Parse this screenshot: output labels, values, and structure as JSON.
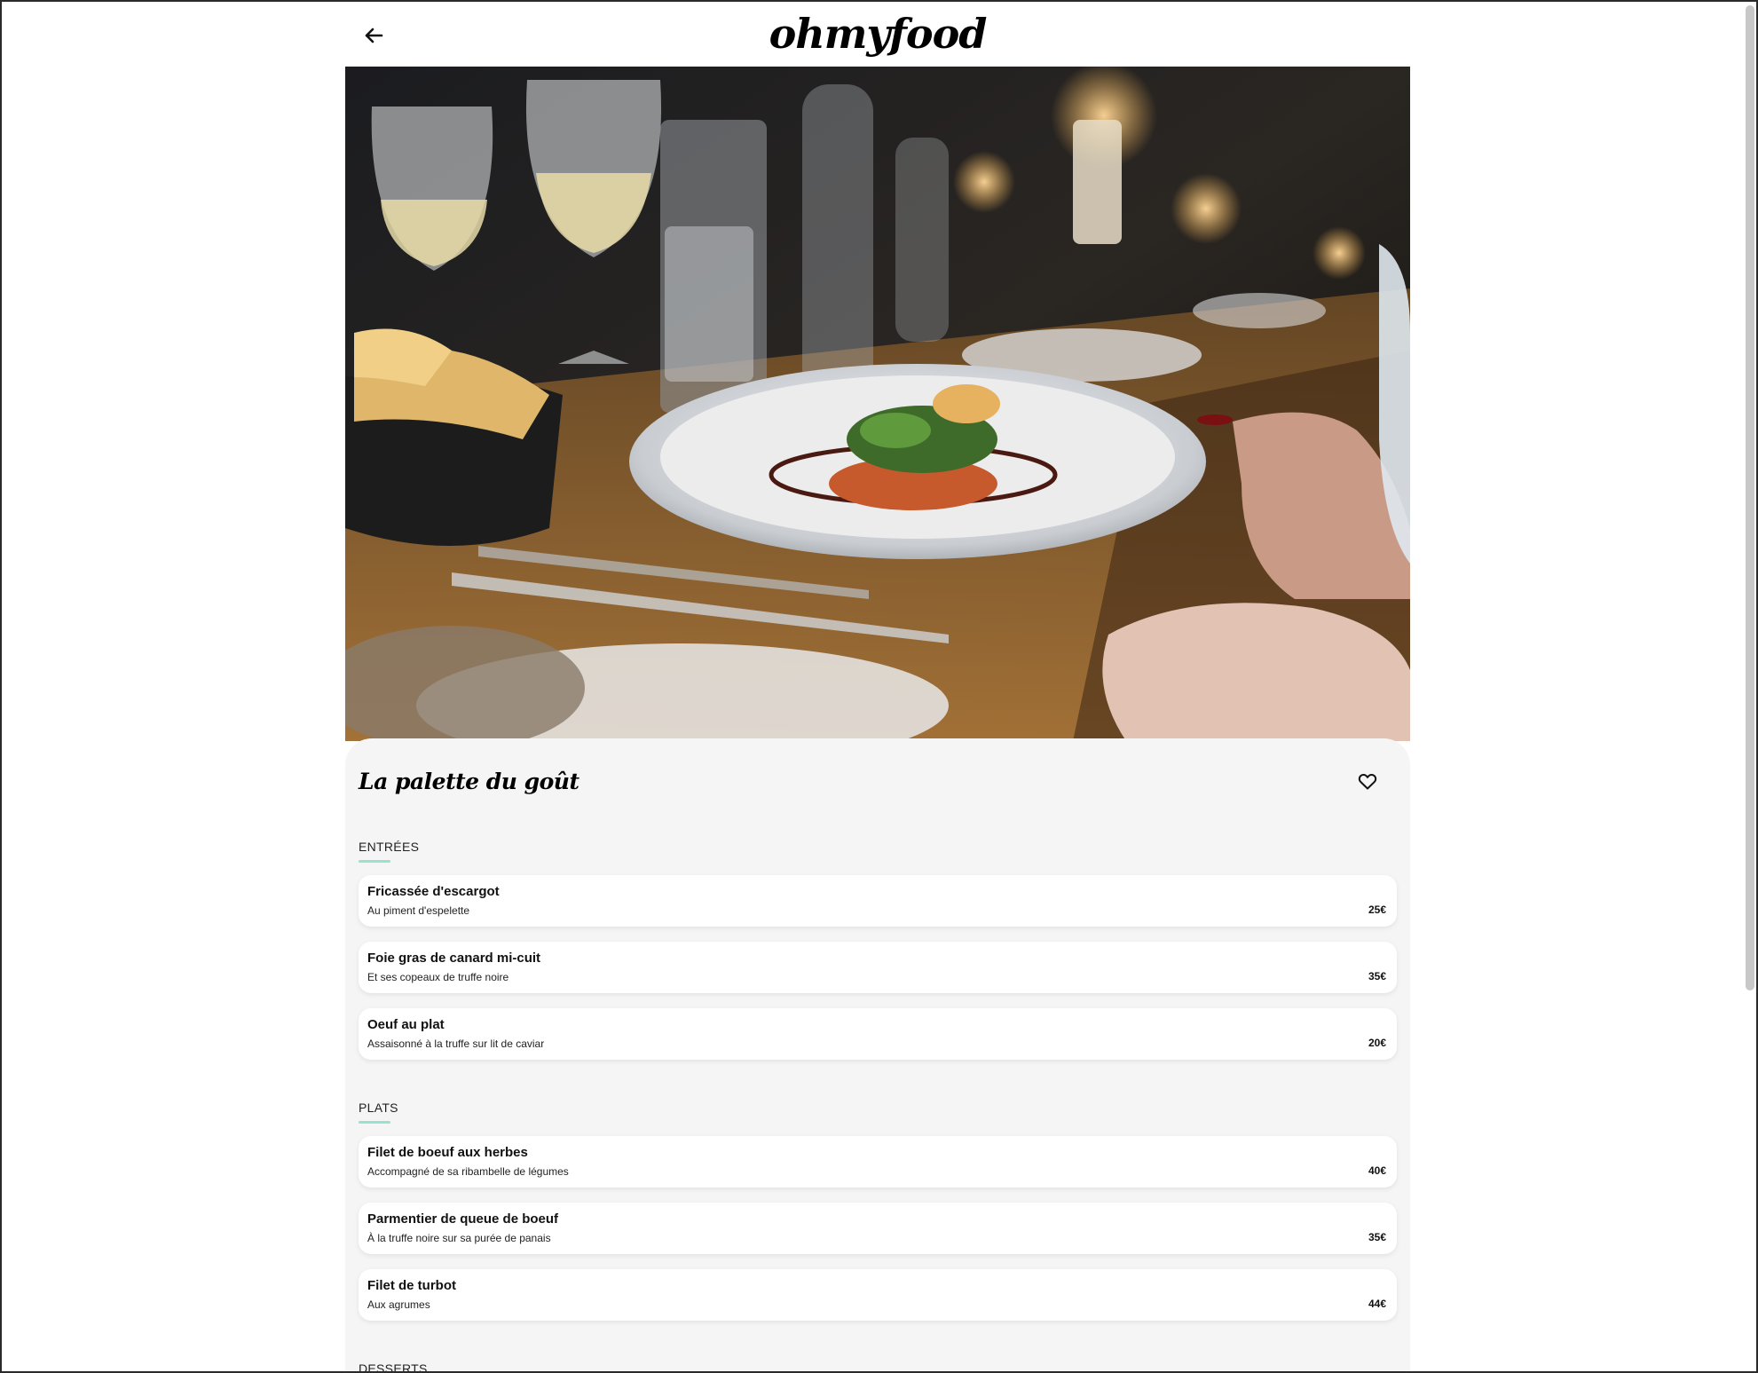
{
  "header": {
    "logo": "ohmyfood",
    "back_icon": "arrow-left-icon"
  },
  "hero": {
    "image": "restaurant-table-photo"
  },
  "restaurant": {
    "name": "La palette du goût",
    "favorite_icon": "heart-outline-icon"
  },
  "colors": {
    "accent": "#99e2d0",
    "panel_bg": "#f5f5f5",
    "card_bg": "#ffffff"
  },
  "menu": {
    "sections": [
      {
        "title": "ENTRÉES",
        "items": [
          {
            "name": "Fricassée d'escargot",
            "description": "Au piment d'espelette",
            "price": "25€"
          },
          {
            "name": "Foie gras de canard mi-cuit",
            "description": "Et ses copeaux de truffe noire",
            "price": "35€"
          },
          {
            "name": "Oeuf au plat",
            "description": "Assaisonné à la truffe sur lit de caviar",
            "price": "20€"
          }
        ]
      },
      {
        "title": "PLATS",
        "items": [
          {
            "name": "Filet de boeuf aux herbes",
            "description": "Accompagné de sa ribambelle de légumes",
            "price": "40€"
          },
          {
            "name": "Parmentier de queue de boeuf",
            "description": "À la truffe noire sur sa purée de panais",
            "price": "35€"
          },
          {
            "name": "Filet de turbot",
            "description": "Aux agrumes",
            "price": "44€"
          }
        ]
      },
      {
        "title": "DESSERTS",
        "items": []
      }
    ]
  }
}
